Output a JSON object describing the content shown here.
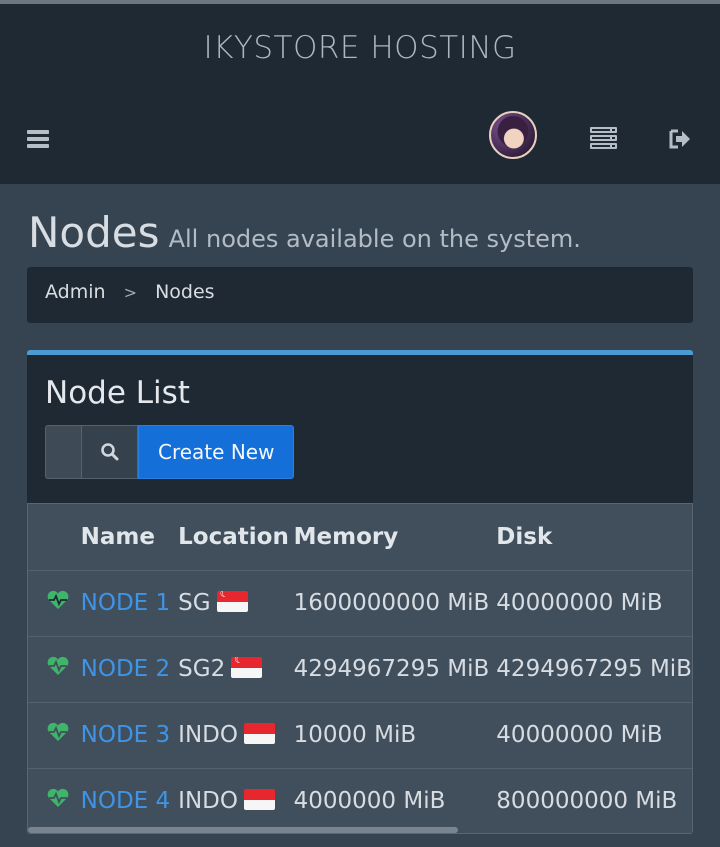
{
  "brand": "IKYSTORE HOSTING",
  "page": {
    "title": "Nodes",
    "subtitle": "All nodes available on the system."
  },
  "breadcrumb": [
    "Admin",
    "Nodes"
  ],
  "breadcrumb_separator": ">",
  "panel": {
    "title": "Node List",
    "search_placeholder": "",
    "create_label": "Create New"
  },
  "table": {
    "columns": [
      "",
      "Name",
      "Location",
      "Memory",
      "Disk"
    ],
    "rows": [
      {
        "status_icon": "heartbeat-icon",
        "name": "NODE 1",
        "location": "SG",
        "flag": "singapore-flag",
        "memory": "1600000000 MiB",
        "disk": "40000000 MiB"
      },
      {
        "status_icon": "heartbeat-icon",
        "name": "NODE 2",
        "location": "SG2",
        "flag": "singapore-flag",
        "memory": "4294967295 MiB",
        "disk": "4294967295 MiB"
      },
      {
        "status_icon": "heartbeat-icon",
        "name": "NODE 3",
        "location": "INDO",
        "flag": "indonesia-flag",
        "memory": "10000 MiB",
        "disk": "40000000 MiB"
      },
      {
        "status_icon": "heartbeat-icon",
        "name": "NODE 4",
        "location": "INDO",
        "flag": "indonesia-flag",
        "memory": "4000000 MiB",
        "disk": "800000000 MiB"
      }
    ]
  },
  "colors": {
    "navbar": "#1f2933",
    "background": "#364451",
    "accent": "#4a9bd4",
    "primary_button": "#1470d8",
    "link": "#3f94e6",
    "status_ok": "#3fb56b"
  }
}
